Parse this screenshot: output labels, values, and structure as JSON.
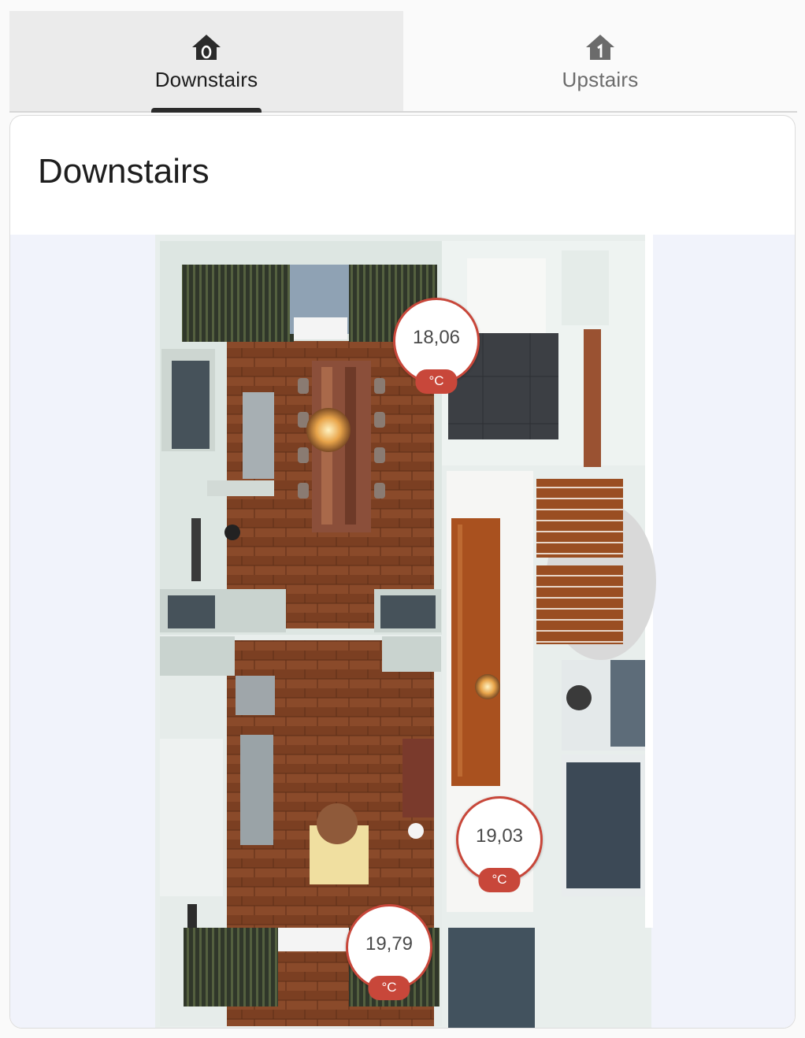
{
  "tabs": [
    {
      "label": "Downstairs",
      "icon": "home-floor-0-icon",
      "active": true
    },
    {
      "label": "Upstairs",
      "icon": "home-floor-1-icon",
      "active": false
    }
  ],
  "card": {
    "title": "Downstairs"
  },
  "sensors": [
    {
      "value": "18,06",
      "unit": "°C"
    },
    {
      "value": "19,03",
      "unit": "°C"
    },
    {
      "value": "19,79",
      "unit": "°C"
    }
  ],
  "colors": {
    "accent": "#c8473a",
    "tab_active_bg": "#ebebeb",
    "indicator": "#2b2b2b"
  }
}
